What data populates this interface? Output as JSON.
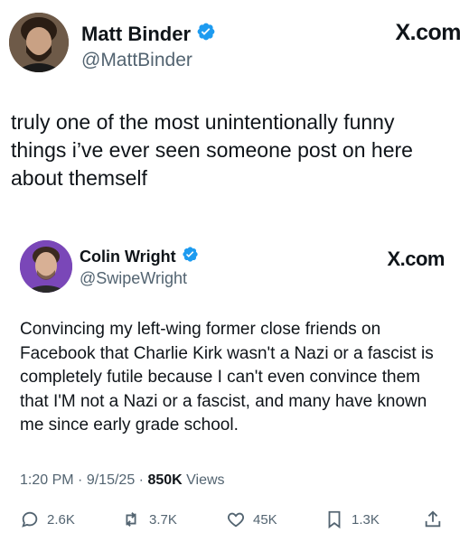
{
  "outer_post": {
    "display_name": "Matt Binder",
    "handle": "@MattBinder",
    "brand": "X.com",
    "text": "truly one of the most unintentionally funny things i’ve ever seen someone post on here about themself"
  },
  "quoted_post": {
    "display_name": "Colin Wright",
    "handle": "@SwipeWright",
    "brand": "X.com",
    "text": "Convincing my left-wing former close friends on Facebook that Charlie Kirk wasn't a Nazi or a fascist is completely futile because I can't even convince them that I'M not a Nazi or a fascist, and many have known me since early grade school.",
    "meta": {
      "time": "1:20 PM",
      "date": "9/15/25",
      "views_count": "850K",
      "views_label": "Views"
    },
    "actions": {
      "replies": "2.6K",
      "reposts": "3.7K",
      "likes": "45K",
      "bookmarks": "1.3K"
    }
  },
  "colors": {
    "verified_badge": "#1d9bf0",
    "text_primary": "#0f1419",
    "text_secondary": "#536471"
  },
  "icons": [
    "verified-badge-icon",
    "reply-icon",
    "repost-icon",
    "like-icon",
    "bookmark-icon",
    "share-icon"
  ]
}
